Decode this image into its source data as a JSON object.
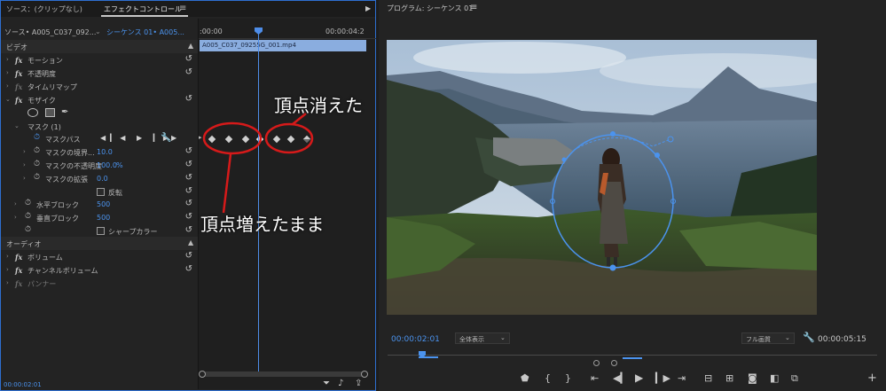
{
  "effect_controls": {
    "tab_source": "ソース：(クリップなし)",
    "tab_effect": "エフェクトコントロール",
    "menu_icon": "≡",
    "source_label": "ソース• A005_C037_092...",
    "sequence_label": "シーケンス 01• A005...",
    "timecode_start": ":00:00",
    "timecode_end": "00:00:04:2",
    "clip_name": "A005_C037_09255G_001.mp4",
    "section_video": "ビデオ",
    "rows": {
      "motion": "モーション",
      "opacity": "不透明度",
      "time_remap": "タイムリマップ",
      "mosaic": "モザイク",
      "mask": "マスク (1)",
      "mask_path": "マスクパス",
      "mask_feather": "マスクの境界...",
      "mask_feather_val": "10.0",
      "mask_opacity": "マスクの不透明度",
      "mask_opacity_val": "100.0",
      "mask_opacity_unit": "%",
      "mask_expansion": "マスクの拡張",
      "mask_expansion_val": "0.0",
      "invert": "反転",
      "h_blocks": "水平ブロック",
      "h_blocks_val": "500",
      "v_blocks": "垂直ブロック",
      "v_blocks_val": "500",
      "sharp_colors": "シャープカラー",
      "section_audio": "オーディオ",
      "volume": "ボリューム",
      "channel_volume": "チャンネルボリューム",
      "panner": "パンナー"
    },
    "fx": "fx",
    "bottom_timecode": "00:00:02:01"
  },
  "annotations": {
    "vertex_disappeared": "頂点消えた",
    "vertex_increased": "頂点増えたまま",
    "color": "#d61a1a"
  },
  "program_monitor": {
    "title": "プログラム: シーケンス 01",
    "menu_icon": "≡",
    "current_time": "00:00:02:01",
    "zoom": "全体表示",
    "quality": "フル画質",
    "duration": "00:00:05:15"
  },
  "colors": {
    "accent": "#4b93ee",
    "panel": "#232323",
    "clip": "#8aaddf"
  }
}
